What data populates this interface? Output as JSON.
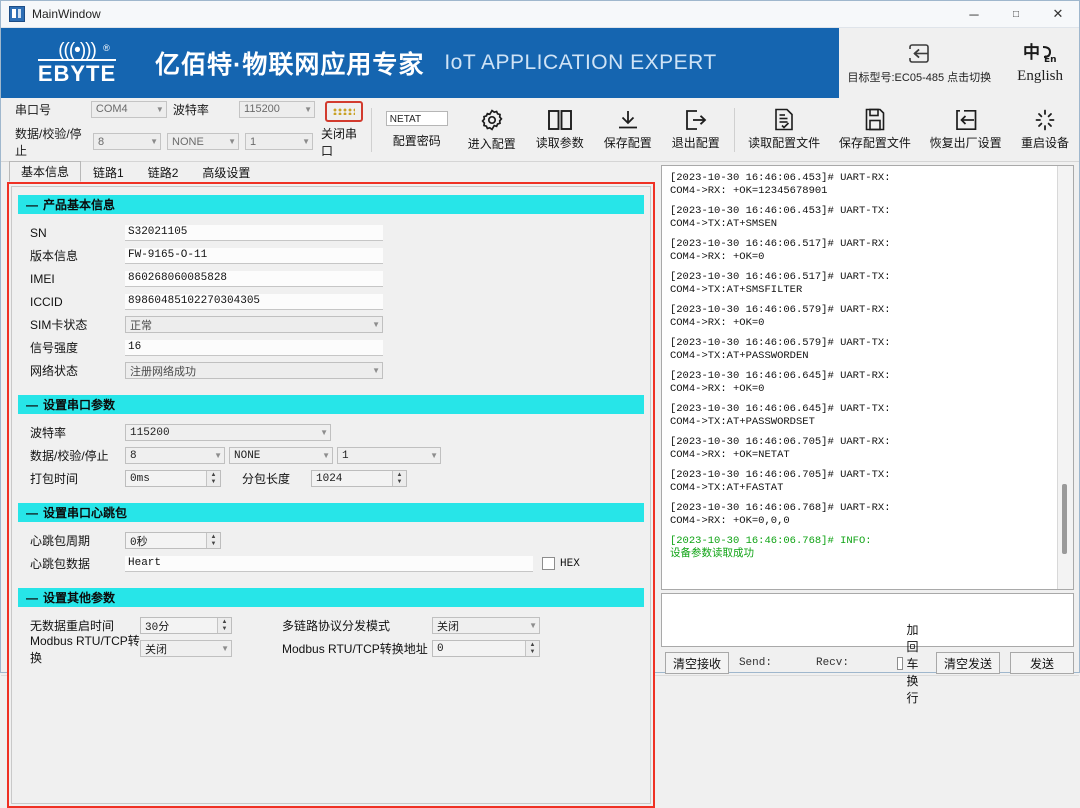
{
  "window": {
    "title": "MainWindow",
    "minimize": "─",
    "maximize": "□",
    "close": "✕"
  },
  "banner": {
    "logo_wave": "(((•)))",
    "logo_reg": "®",
    "logo_text": "EBYTE",
    "cn_title": "亿佰特·物联网应用专家",
    "en_title": "IoT APPLICATION EXPERT",
    "model_label": "目标型号:EC05-485 点击切换",
    "language_label": "English"
  },
  "toolbar": {
    "port_label": "串口号",
    "port_value": "COM4",
    "baud_label": "波特率",
    "baud_value": "115200",
    "dps_label": "数据/校验/停止",
    "data_bits": "8",
    "parity": "NONE",
    "stop_bits": "1",
    "close_port": "关闭串口",
    "password_value": "NETAT",
    "password_label": "配置密码",
    "buttons": [
      {
        "label": "进入配置",
        "icon": "gear-icon"
      },
      {
        "label": "读取参数",
        "icon": "book-icon"
      },
      {
        "label": "保存配置",
        "icon": "download-icon"
      },
      {
        "label": "退出配置",
        "icon": "exit-icon"
      },
      {
        "label": "读取配置文件",
        "icon": "document-icon"
      },
      {
        "label": "保存配置文件",
        "icon": "save-icon"
      },
      {
        "label": "恢复出厂设置",
        "icon": "restore-icon"
      },
      {
        "label": "重启设备",
        "icon": "restart-icon"
      }
    ]
  },
  "tabs": [
    {
      "label": "基本信息",
      "active": true
    },
    {
      "label": "链路1",
      "active": false
    },
    {
      "label": "链路2",
      "active": false
    },
    {
      "label": "高级设置",
      "active": false
    }
  ],
  "sections": {
    "product": {
      "title": "产品基本信息",
      "sn_label": "SN",
      "sn_value": "S32021105",
      "fw_label": "版本信息",
      "fw_value": "FW-9165-O-11",
      "imei_label": "IMEI",
      "imei_value": "860268060085828",
      "iccid_label": "ICCID",
      "iccid_value": "89860485102270304305",
      "sim_label": "SIM卡状态",
      "sim_value": "正常",
      "signal_label": "信号强度",
      "signal_value": "16",
      "net_label": "网络状态",
      "net_value": "注册网络成功"
    },
    "serial": {
      "title": "设置串口参数",
      "baud_label": "波特率",
      "baud_value": "115200",
      "dps_label": "数据/校验/停止",
      "data_bits": "8",
      "parity": "NONE",
      "stop_bits": "1",
      "pack_time_label": "打包时间",
      "pack_time_value": "0ms",
      "pack_len_label": "分包长度",
      "pack_len_value": "1024"
    },
    "heartbeat": {
      "title": "设置串口心跳包",
      "period_label": "心跳包周期",
      "period_value": "0秒",
      "data_label": "心跳包数据",
      "data_value": "Heart",
      "hex_label": "HEX"
    },
    "other": {
      "title": "设置其他参数",
      "nodata_label": "无数据重启时间",
      "nodata_value": "30分",
      "multilink_label": "多链路协议分发模式",
      "multilink_value": "关闭",
      "modbus_label": "Modbus RTU/TCP转换",
      "modbus_value": "关闭",
      "modbus_addr_label": "Modbus RTU/TCP转换地址",
      "modbus_addr_value": "0"
    }
  },
  "log": {
    "entries": [
      {
        "head": "[2023-10-30 16:46:06.453]# UART-RX:",
        "body": "COM4->RX: +OK=12345678901",
        "type": "normal"
      },
      {
        "head": "[2023-10-30 16:46:06.453]# UART-TX:",
        "body": "COM4->TX:AT+SMSEN",
        "type": "normal"
      },
      {
        "head": "[2023-10-30 16:46:06.517]# UART-RX:",
        "body": "COM4->RX: +OK=0",
        "type": "normal"
      },
      {
        "head": "[2023-10-30 16:46:06.517]# UART-TX:",
        "body": "COM4->TX:AT+SMSFILTER",
        "type": "normal"
      },
      {
        "head": "[2023-10-30 16:46:06.579]# UART-RX:",
        "body": "COM4->RX: +OK=0",
        "type": "normal"
      },
      {
        "head": "[2023-10-30 16:46:06.579]# UART-TX:",
        "body": "COM4->TX:AT+PASSWORDEN",
        "type": "normal"
      },
      {
        "head": "[2023-10-30 16:46:06.645]# UART-RX:",
        "body": "COM4->RX: +OK=0",
        "type": "normal"
      },
      {
        "head": "[2023-10-30 16:46:06.645]# UART-TX:",
        "body": "COM4->TX:AT+PASSWORDSET",
        "type": "normal"
      },
      {
        "head": "[2023-10-30 16:46:06.705]# UART-RX:",
        "body": "COM4->RX: +OK=NETAT",
        "type": "normal"
      },
      {
        "head": "[2023-10-30 16:46:06.705]# UART-TX:",
        "body": "COM4->TX:AT+FASTAT",
        "type": "normal"
      },
      {
        "head": "[2023-10-30 16:46:06.768]# UART-RX:",
        "body": "COM4->RX: +OK=0,0,0",
        "type": "normal"
      },
      {
        "head": "[2023-10-30 16:46:06.768]# INFO:",
        "body": "设备参数读取成功",
        "type": "info"
      }
    ]
  },
  "bottom": {
    "clear_recv": "清空接收",
    "send_label": "Send:",
    "recv_label": "Recv:",
    "crlf_label": "加回车换行",
    "clear_send": "清空发送",
    "send": "发送"
  },
  "colors": {
    "brand_blue": "#1565b0",
    "section_cyan": "#27e5e8",
    "panel_red": "#ef3124",
    "info_green": "#0fa314"
  }
}
